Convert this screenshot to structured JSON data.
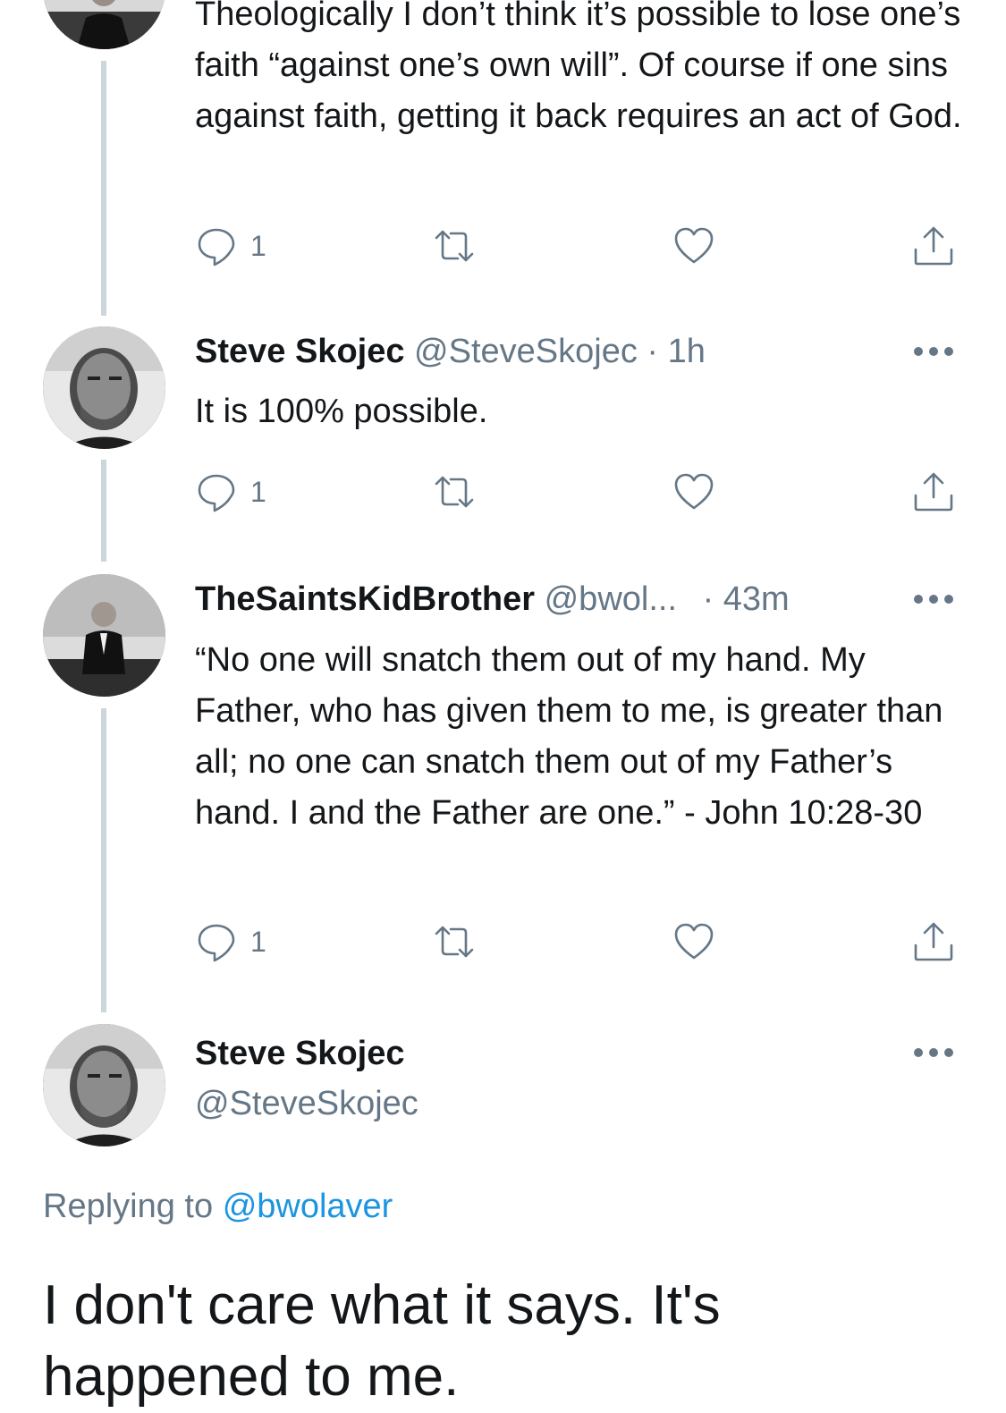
{
  "tweets": [
    {
      "text": "Theologically I don’t think it’s possible to lose one’s faith “against one’s own will”. Of course if one sins against faith, getting it back requires an act of God.",
      "reply_count": "1"
    },
    {
      "name": "Steve Skojec",
      "handle": "@SteveSkojec",
      "time": "· 1h",
      "text": "It is 100% possible.",
      "reply_count": "1"
    },
    {
      "name": "TheSaintsKidBrother",
      "handle": "@bwol...",
      "time": "· 43m",
      "text": "“No one will snatch them out of my hand. My Father, who has given them to me, is greater than all; no one can snatch them out of my Father’s hand. I and the Father are one.” - John 10:28-30",
      "reply_count": "1"
    }
  ],
  "main_tweet": {
    "name": "Steve Skojec",
    "handle": "@SteveSkojec",
    "replying_prefix": "Replying to",
    "replying_to": "@bwolaver",
    "text": "I don't care what it says. It's happened to me."
  },
  "icons": {
    "reply": "reply-bubble-icon",
    "retweet": "retweet-icon",
    "like": "heart-icon",
    "share": "share-icon",
    "more": "more-dots-icon"
  },
  "colors": {
    "text": "#14171a",
    "secondary": "#657786",
    "link": "#1b95e0",
    "thread_line": "#ccd6dd"
  }
}
